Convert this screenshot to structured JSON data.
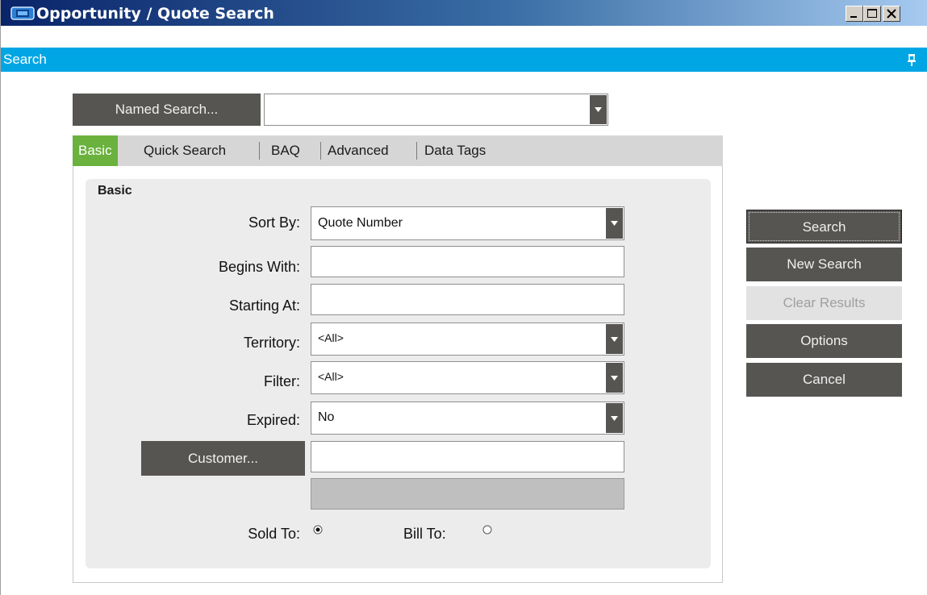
{
  "window": {
    "title": "Opportunity / Quote Search",
    "controls": [
      "minimize-icon",
      "maximize-icon",
      "close-icon"
    ]
  },
  "search_panel": {
    "label": "Search",
    "pin_icon": "pin-icon"
  },
  "named_search": {
    "button_label": "Named Search...",
    "value": ""
  },
  "tabs": [
    {
      "label": "Basic",
      "active": true
    },
    {
      "label": "Quick Search",
      "active": false
    },
    {
      "label": "BAQ",
      "active": false
    },
    {
      "label": "Advanced",
      "active": false
    },
    {
      "label": "Data Tags",
      "active": false
    }
  ],
  "basic": {
    "group_title": "Basic",
    "sort_by": {
      "label": "Sort By:",
      "value": "Quote Number"
    },
    "begins_with": {
      "label": "Begins With:",
      "value": ""
    },
    "starting_at": {
      "label": "Starting At:",
      "value": ""
    },
    "territory": {
      "label": "Territory:",
      "value": "<All>"
    },
    "filter": {
      "label": "Filter:",
      "value": "<All>"
    },
    "expired": {
      "label": "Expired:",
      "value": "No"
    },
    "customer": {
      "button_label": "Customer...",
      "value": "",
      "name_value": ""
    },
    "sold_to": {
      "label": "Sold To:",
      "selected": true
    },
    "bill_to": {
      "label": "Bill To:",
      "selected": false
    }
  },
  "actions": {
    "search": "Search",
    "new_search": "New Search",
    "clear_results": "Clear Results",
    "options": "Options",
    "cancel": "Cancel"
  },
  "colors": {
    "title_gradient_start": "#0a246a",
    "search_bar": "#00a6e4",
    "active_tab": "#6ab23d",
    "button": "#575552"
  }
}
